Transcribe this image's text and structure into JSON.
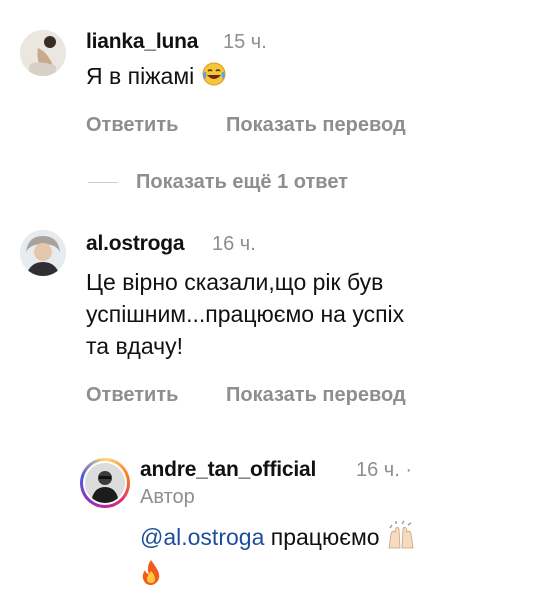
{
  "comments": [
    {
      "username": "lianka_luna",
      "time": "15 ч.",
      "text": "Я в піжамі",
      "emoji_icon": "tears-of-joy-emoji",
      "reply_label": "Ответить",
      "translate_label": "Показать перевод"
    },
    {
      "username": "al.ostroga",
      "time": "16 ч.",
      "text_lines": [
        "Це вірно сказали,що рік був",
        "успішним...працюємо на успіх",
        "та вдачу!"
      ],
      "reply_label": "Ответить",
      "translate_label": "Показать перевод"
    }
  ],
  "show_more_replies": "Показать ещё 1 ответ",
  "reply": {
    "username": "andre_tan_official",
    "time": "16 ч. ·",
    "author_badge": "Автор",
    "mention": "@al.ostroga",
    "text": "працюємо",
    "emoji_icons": [
      "raising-hands-emoji",
      "fire-emoji"
    ],
    "story_ring_color": "#e1306c"
  },
  "colors": {
    "mention": "#1e4e9b",
    "secondary_text": "#8e8e8e"
  }
}
